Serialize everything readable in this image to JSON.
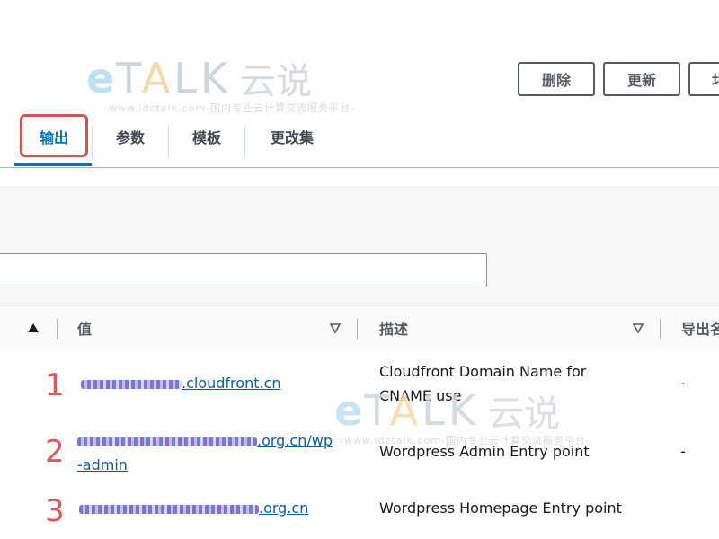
{
  "watermark": {
    "brand_mark": "e",
    "brand_word_1": "T",
    "brand_word_a": "A",
    "brand_word_2": "LK",
    "brand_cn": "云说",
    "subtitle": "-www.idctalk.com-国内专业云计算交流服务平台-"
  },
  "toolbar": {
    "delete_label": "删除",
    "update_label": "更新",
    "partial_label": "圠"
  },
  "tabs": [
    {
      "label": "输出",
      "active": true
    },
    {
      "label": "参数",
      "active": false
    },
    {
      "label": "模板",
      "active": false
    },
    {
      "label": "更改集",
      "active": false
    }
  ],
  "filter": {
    "placeholder": "",
    "value": ""
  },
  "table": {
    "columns": [
      {
        "label": ""
      },
      {
        "label": "值"
      },
      {
        "label": "描述"
      },
      {
        "label": "导出名"
      }
    ],
    "rows": [
      {
        "marker": "1",
        "value_suffix": ".cloudfront.cn",
        "description_line1": "Cloudfront Domain Name for",
        "description_line2": "CNAME use",
        "export": "-"
      },
      {
        "marker": "2",
        "value_suffix": ".org.cn/wp",
        "value_line2": "-admin",
        "description": "Wordpress Admin Entry point",
        "export": "-"
      },
      {
        "marker": "3",
        "value_suffix": ".org.cn",
        "description": "Wordpress Homepage Entry point",
        "export": ""
      }
    ]
  },
  "colors": {
    "accent": "#0073bb",
    "highlight": "#d9534f",
    "marker": "#e05555"
  }
}
